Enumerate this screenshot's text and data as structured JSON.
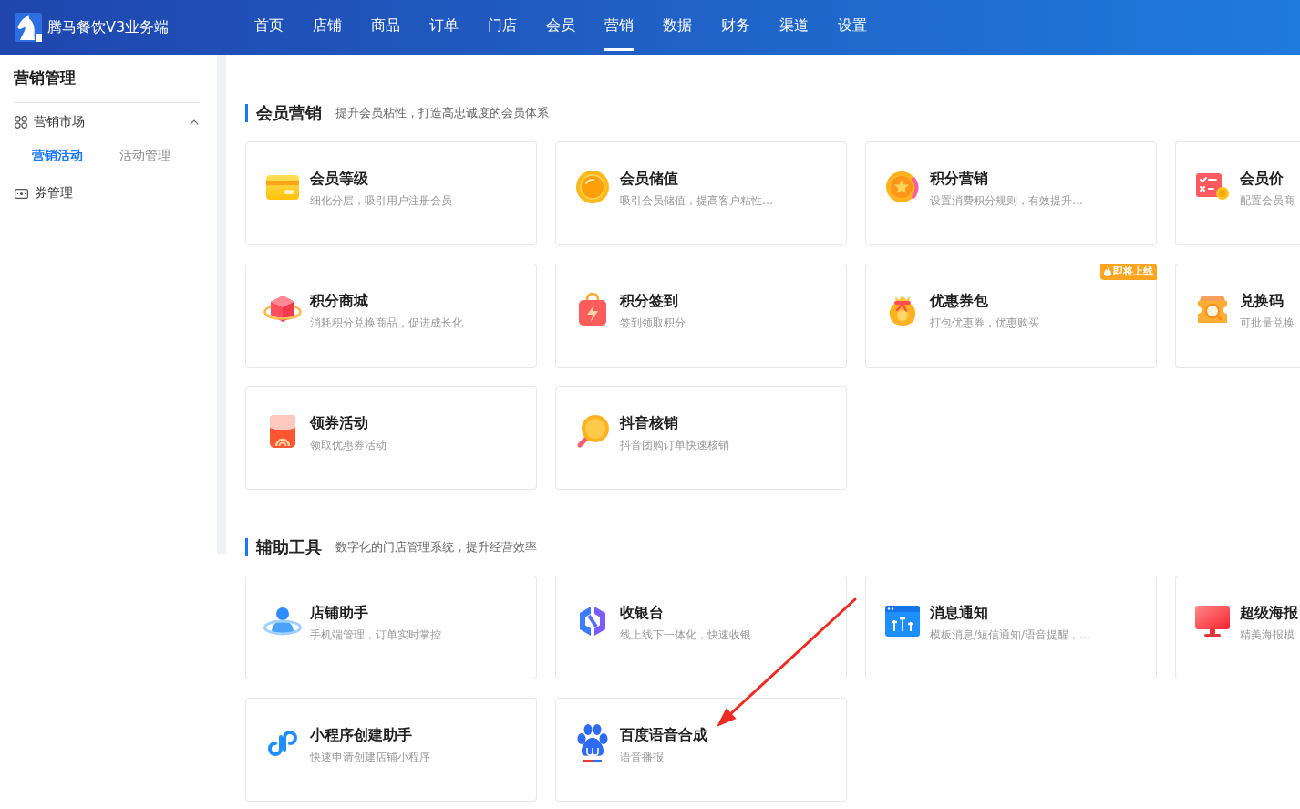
{
  "topbar": {
    "brand": "腾马餐饮V3业务端",
    "tabs": [
      {
        "label": "首页",
        "selected": false
      },
      {
        "label": "店铺",
        "selected": false
      },
      {
        "label": "商品",
        "selected": false
      },
      {
        "label": "订单",
        "selected": false
      },
      {
        "label": "门店",
        "selected": false
      },
      {
        "label": "会员",
        "selected": false
      },
      {
        "label": "营销",
        "selected": true
      },
      {
        "label": "数据",
        "selected": false
      },
      {
        "label": "财务",
        "selected": false
      },
      {
        "label": "渠道",
        "selected": false
      },
      {
        "label": "设置",
        "selected": false
      }
    ]
  },
  "sidebar": {
    "title": "营销管理",
    "items": [
      {
        "kind": "group",
        "label": "营销市场",
        "expanded": true,
        "children": [
          {
            "label": "营销活动",
            "selected": true
          },
          {
            "label": "活动管理",
            "selected": false
          }
        ]
      },
      {
        "kind": "link",
        "label": "券管理",
        "selected": false
      }
    ]
  },
  "sections": [
    {
      "title": "会员营销",
      "subtitle": "提升会员粘性，打造高忠诚度的会员体系",
      "cards": [
        {
          "title": "会员等级",
          "description": "细化分层，吸引用户注册会员"
        },
        {
          "title": "会员储值",
          "description": "吸引会员储值，提高客户粘性…"
        },
        {
          "title": "积分营销",
          "description": "设置消费积分规则，有效提升…"
        },
        {
          "title": "会员价",
          "description": "配置会员商"
        },
        {
          "title": "积分商城",
          "description": "消耗积分兑换商品，促进成长化"
        },
        {
          "title": "积分签到",
          "description": "签到领取积分"
        },
        {
          "title": "优惠券包",
          "description": "打包优惠券，优惠购买",
          "badge": "即将上线"
        },
        {
          "title": "兑换码",
          "description": "可批量兑换"
        },
        {
          "title": "领券活动",
          "description": "领取优惠券活动"
        },
        {
          "title": "抖音核销",
          "description": "抖音团购订单快速核销"
        }
      ]
    },
    {
      "title": "辅助工具",
      "subtitle": "数字化的门店管理系统，提升经营效率",
      "cards": [
        {
          "title": "店铺助手",
          "description": "手机端管理，订单实时掌控"
        },
        {
          "title": "收银台",
          "description": "线上线下一体化，快速收银"
        },
        {
          "title": "消息通知",
          "description": "模板消息/短信通知/语音提醒，…"
        },
        {
          "title": "超级海报",
          "description": "精美海报模"
        },
        {
          "title": "小程序创建助手",
          "description": "快速申请创建店铺小程序"
        },
        {
          "title": "百度语音合成",
          "description": "语音播报"
        }
      ]
    }
  ],
  "annotations": [
    {
      "kind": "arrow"
    }
  ]
}
